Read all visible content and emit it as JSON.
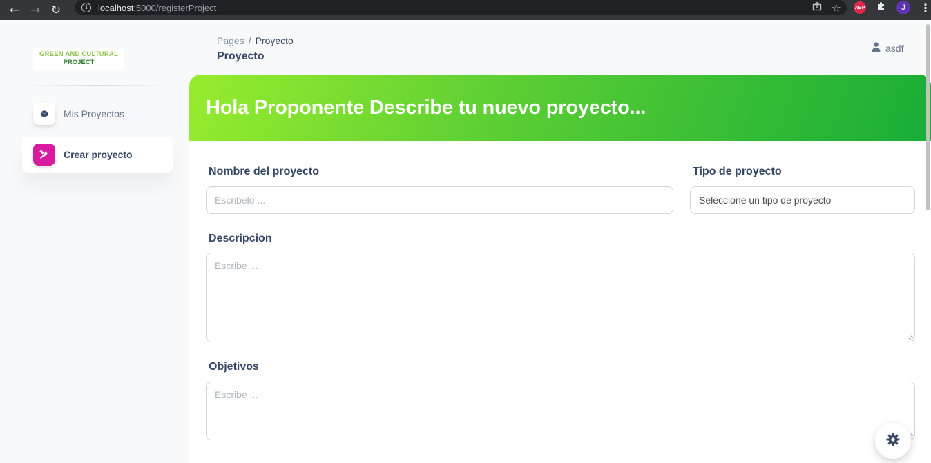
{
  "browser": {
    "url_host": "localhost",
    "url_path": ":5000/registerProject",
    "abp_label": "ABP",
    "profile_initial": "J"
  },
  "sidebar": {
    "logo_line1": "GREEN AND CULTURAL",
    "logo_line2": "PROJECT",
    "items": [
      {
        "label": "Mis Proyectos",
        "icon": "box-icon",
        "active": false
      },
      {
        "label": "Crear proyecto",
        "icon": "tools-icon",
        "active": true
      }
    ]
  },
  "header": {
    "breadcrumb_root": "Pages",
    "breadcrumb_separator": "/",
    "breadcrumb_current": "Proyecto",
    "title": "Proyecto",
    "user_name": "asdf"
  },
  "card": {
    "heading": "Hola Proponente Describe tu nuevo proyecto...",
    "accent_start": "#98ec2d",
    "accent_end": "#17ad37"
  },
  "form": {
    "name_label": "Nombre del proyecto",
    "name_placeholder": "Escribelo ...",
    "type_label": "Tipo de proyecto",
    "type_selected": "Seleccione un tipo de proyecto",
    "description_label": "Descripcion",
    "description_placeholder": "Escribe ...",
    "objectives_label": "Objetivos",
    "objectives_placeholder": "Escribe ..."
  }
}
